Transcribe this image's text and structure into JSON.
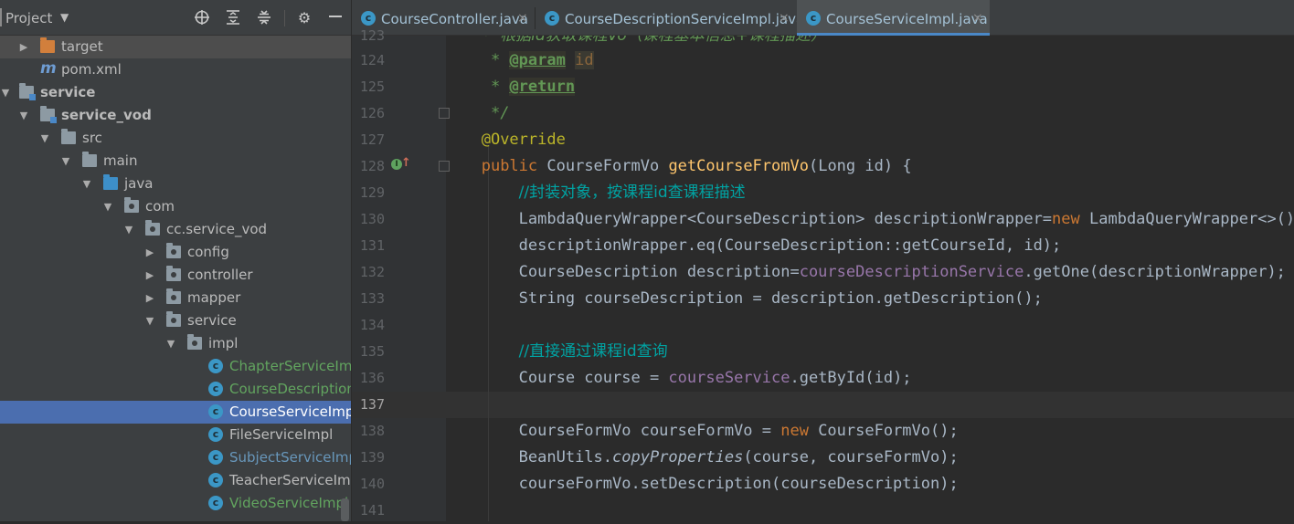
{
  "project_panel": {
    "title": "Project",
    "dropdown_icon": "triangle-down",
    "toolbar_icons": [
      "locate-icon",
      "expand-all-icon",
      "collapse-all-icon",
      "gear-icon",
      "minimize-icon"
    ],
    "tree": [
      {
        "label": "target",
        "icon": "folder-orange",
        "expanded": false
      },
      {
        "label": "pom.xml",
        "icon": "maven-icon"
      },
      {
        "label": "service",
        "icon": "module-folder",
        "expanded": true,
        "bold": true
      },
      {
        "label": "service_vod",
        "icon": "module-folder",
        "expanded": true,
        "bold": true
      },
      {
        "label": "src",
        "icon": "folder",
        "expanded": true
      },
      {
        "label": "main",
        "icon": "folder",
        "expanded": true
      },
      {
        "label": "java",
        "icon": "source-folder",
        "expanded": true
      },
      {
        "label": "com",
        "icon": "package",
        "expanded": true
      },
      {
        "label": "cc.service_vod",
        "icon": "package",
        "expanded": true
      },
      {
        "label": "config",
        "icon": "package",
        "expanded": false
      },
      {
        "label": "controller",
        "icon": "package",
        "expanded": false
      },
      {
        "label": "mapper",
        "icon": "package",
        "expanded": false
      },
      {
        "label": "service",
        "icon": "package",
        "expanded": true
      },
      {
        "label": "impl",
        "icon": "package",
        "expanded": true
      },
      {
        "label": "ChapterServiceImpl",
        "icon": "class-icon",
        "color": "#62a55f"
      },
      {
        "label": "CourseDescriptionServiceImpl",
        "icon": "class-icon",
        "color": "#62a55f"
      },
      {
        "label": "CourseServiceImpl",
        "icon": "class-icon",
        "color": "#ffffff",
        "selected": true
      },
      {
        "label": "FileServiceImpl",
        "icon": "class-icon",
        "color": "#bbbbbb"
      },
      {
        "label": "SubjectServiceImpl",
        "icon": "class-icon",
        "color": "#6897bb"
      },
      {
        "label": "TeacherServiceImpl",
        "icon": "class-icon",
        "color": "#bbbbbb"
      },
      {
        "label": "VideoServiceImpl",
        "icon": "class-icon",
        "color": "#62a55f"
      }
    ]
  },
  "tabs": [
    {
      "label": "CourseController.java",
      "close": "×",
      "active": false
    },
    {
      "label": "CourseDescriptionServiceImpl.java",
      "close": "×",
      "active": false
    },
    {
      "label": "CourseServiceImpl.java",
      "close": "×",
      "active": true
    }
  ],
  "editor": {
    "current_line": 137,
    "lines": [
      {
        "n": "123",
        "text": "     * 根据id获取课程Vo（课程基本信息+课程描述）"
      },
      {
        "n": "124",
        "text": "     * @param id"
      },
      {
        "n": "125",
        "text": "     * @return"
      },
      {
        "n": "126",
        "text": "     */"
      },
      {
        "n": "127",
        "text": "    @Override"
      },
      {
        "n": "128",
        "text": "    public CourseFormVo getCourseFromVo(Long id) {"
      },
      {
        "n": "129",
        "text": "        //封装对象，按课程id查课程描述"
      },
      {
        "n": "130",
        "text": "        LambdaQueryWrapper<CourseDescription> descriptionWrapper=new LambdaQueryWrapper<>();"
      },
      {
        "n": "131",
        "text": "        descriptionWrapper.eq(CourseDescription::getCourseId, id);"
      },
      {
        "n": "132",
        "text": "        CourseDescription description=courseDescriptionService.getOne(descriptionWrapper);"
      },
      {
        "n": "133",
        "text": "        String courseDescription = description.getDescription();"
      },
      {
        "n": "134",
        "text": ""
      },
      {
        "n": "135",
        "text": "        //直接通过课程id查询"
      },
      {
        "n": "136",
        "text": "        Course course = courseService.getById(id);"
      },
      {
        "n": "137",
        "text": ""
      },
      {
        "n": "138",
        "text": "        CourseFormVo courseFormVo = new CourseFormVo();"
      },
      {
        "n": "139",
        "text": "        BeanUtils.copyProperties(course, courseFormVo);"
      },
      {
        "n": "140",
        "text": "        courseFormVo.setDescription(courseDescription);"
      },
      {
        "n": "141",
        "text": ""
      }
    ],
    "tokens": {
      "l123_cm": "根据id获取课程Vo（课程基本信息+课程描述）",
      "l124_star": " * ",
      "l124_tag": "@param",
      "l124_sp": " ",
      "l124_p": "id",
      "l125_star": " * ",
      "l125_tag": "@return",
      "l126": " */",
      "l127": "@Override",
      "l128_kw": "public",
      "l128_a": " CourseFormVo ",
      "l128_fn": "getCourseFromVo",
      "l128_b": "(Long id) {",
      "l129": "//封装对象，按课程id查课程描述",
      "l130_a": "LambdaQueryWrapper<CourseDescription> descriptionWrapper=",
      "l130_kw": "new",
      "l130_b": " LambdaQueryWrapper<>();",
      "l131": "descriptionWrapper.eq(CourseDescription::getCourseId, id);",
      "l132_a": "CourseDescription description=",
      "l132_f": "courseDescriptionService",
      "l132_b": ".getOne(descriptionWrapper);",
      "l133": "String courseDescription = description.getDescription();",
      "l135": "//直接通过课程id查询",
      "l136_a": "Course course = ",
      "l136_f": "courseService",
      "l136_b": ".getById(id);",
      "l138_a": "CourseFormVo courseFormVo = ",
      "l138_kw": "new",
      "l138_b": " CourseFormVo();",
      "l139_a": "BeanUtils.",
      "l139_i": "copyProperties",
      "l139_b": "(course, courseFormVo);",
      "l140": "courseFormVo.setDescription(courseDescription);"
    }
  },
  "colors": {
    "selection": "#4b6eaf",
    "keyword": "#cc7832",
    "function": "#ffc66d",
    "field": "#9876aa",
    "comment": "#00a3a3",
    "doc": "#629755",
    "annotation": "#bbb529"
  }
}
